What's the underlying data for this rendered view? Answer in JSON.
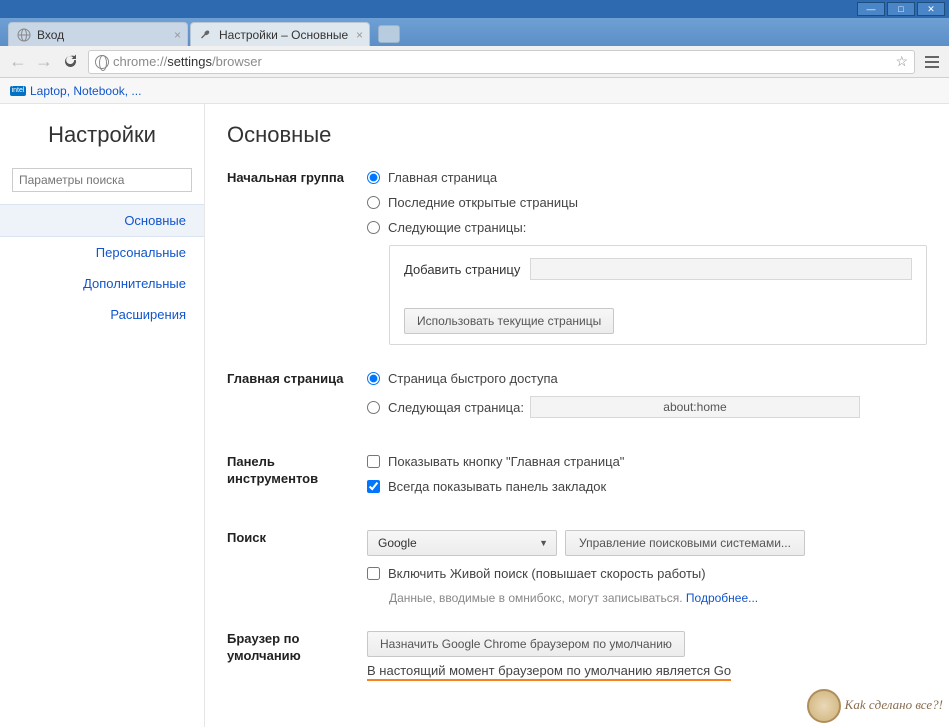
{
  "window": {
    "tabs": [
      {
        "title": "Вход",
        "active": false
      },
      {
        "title": "Настройки – Основные",
        "active": true
      }
    ]
  },
  "toolbar": {
    "url_prefix": "chrome://",
    "url_path_1": "settings",
    "url_path_2": "/browser"
  },
  "bookmarks": {
    "item1": "Laptop, Notebook, ..."
  },
  "sidebar": {
    "title": "Настройки",
    "search_placeholder": "Параметры поиска",
    "items": [
      "Основные",
      "Персональные",
      "Дополнительные",
      "Расширения"
    ]
  },
  "content": {
    "title": "Основные",
    "startup": {
      "label": "Начальная группа",
      "opt1": "Главная страница",
      "opt2": "Последние открытые страницы",
      "opt3": "Следующие страницы:",
      "add_page": "Добавить страницу",
      "use_current": "Использовать текущие страницы"
    },
    "homepage": {
      "label": "Главная страница",
      "opt1": "Страница быстрого доступа",
      "opt2": "Следующая страница:",
      "value": "about:home"
    },
    "toolbar_panel": {
      "label": "Панель инструментов",
      "chk1": "Показывать кнопку \"Главная страница\"",
      "chk2": "Всегда показывать панель закладок"
    },
    "search": {
      "label": "Поиск",
      "engine": "Google",
      "manage": "Управление поисковыми системами...",
      "instant": "Включить Живой поиск (повышает скорость работы)",
      "hint": "Данные, вводимые в омнибокс, могут записываться. ",
      "more": "Подробнее..."
    },
    "default_browser": {
      "label": "Браузер по умолчанию",
      "button": "Назначить Google Chrome браузером по умолчанию",
      "status": "В настоящий момент браузером по умолчанию является Go"
    }
  }
}
